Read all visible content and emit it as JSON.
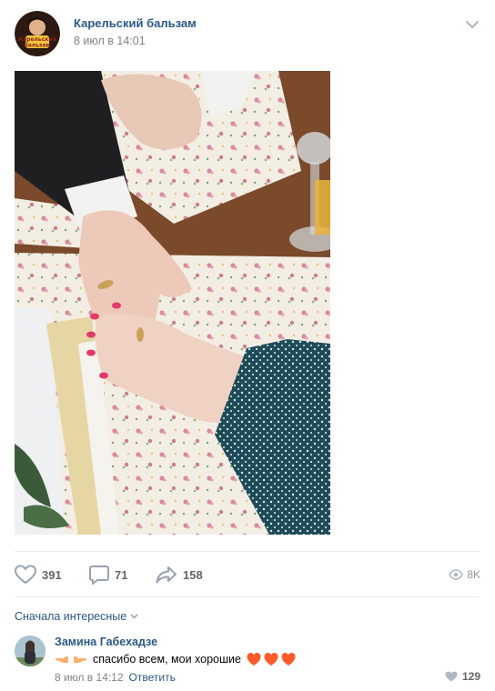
{
  "post": {
    "author": "Карельский бальзам",
    "avatar_text": "Карельский бальзам",
    "date": "8 июл в 14:01",
    "menu_icon": "chevron-down-icon",
    "photo_icon": "post-photo"
  },
  "actions": {
    "likes": "391",
    "comments": "71",
    "shares": "158",
    "views": "8K"
  },
  "comments_sort": {
    "label": "Сначала интересные"
  },
  "comment": {
    "author": "Замина Габехадзе",
    "text": "спасибо всем, мои хорошие",
    "date": "8 июл в 14:12",
    "reply_label": "Ответить",
    "likes": "129"
  },
  "colors": {
    "link": "#2a5885",
    "muted": "#828282",
    "heart": "#ff5a2c"
  }
}
